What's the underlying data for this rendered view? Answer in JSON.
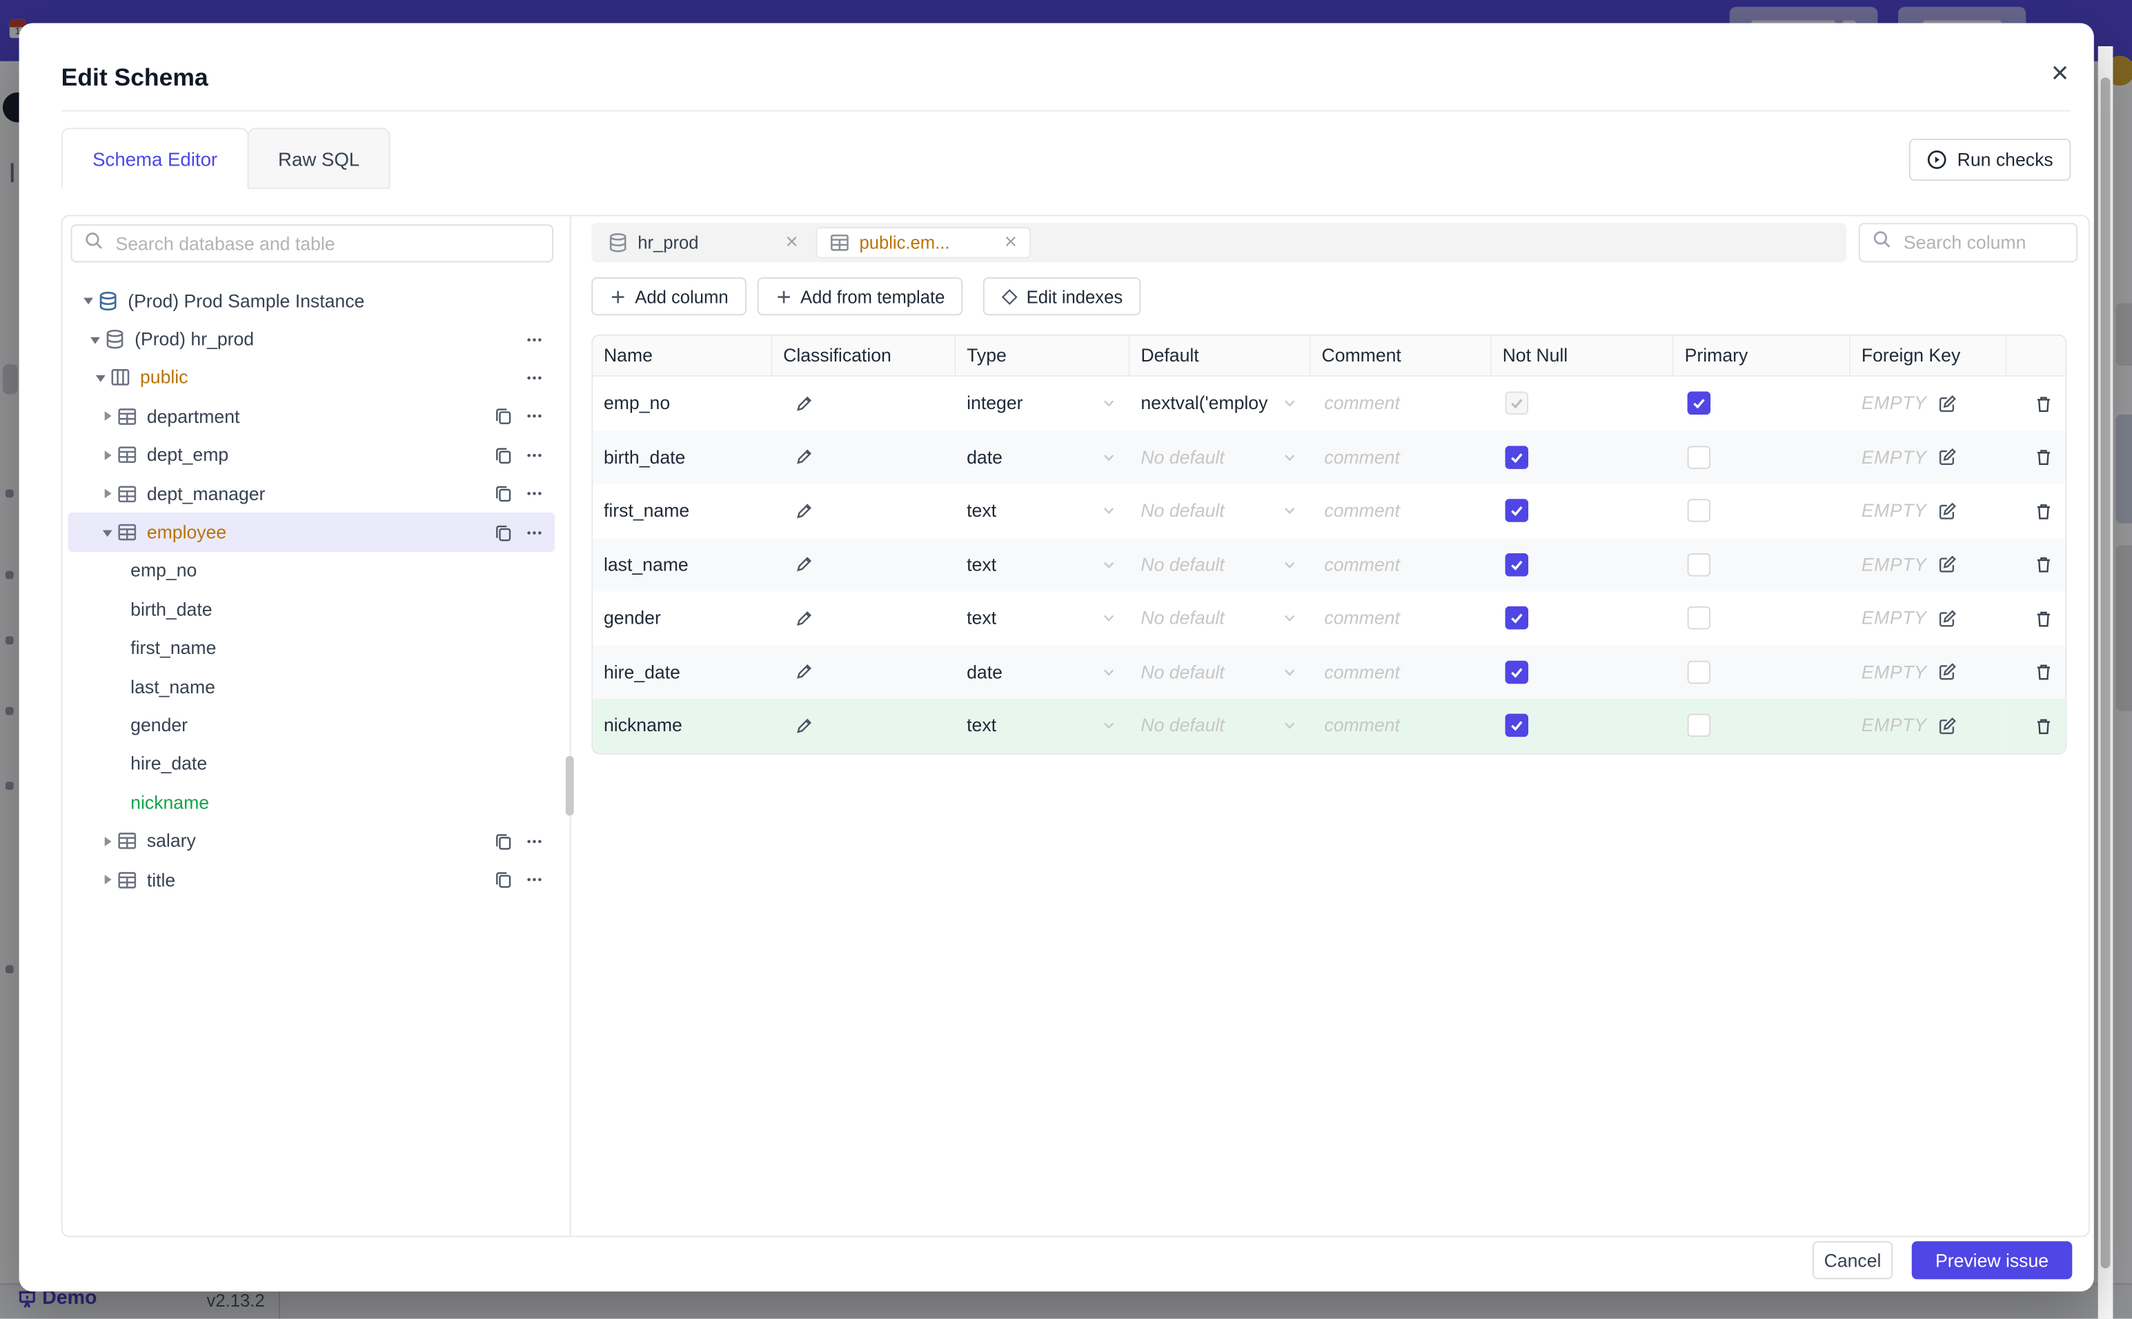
{
  "colors": {
    "accent_indigo": "#4f46e5",
    "header_purple": "#4b43d6",
    "amber_highlight": "#b87309",
    "green_added": "#15a34a",
    "added_row_bg": "#e8f7ee",
    "selected_tree_bg": "#ebeafb"
  },
  "underlay": {
    "demo_label": "Demo",
    "version": "v2.13.2"
  },
  "modal": {
    "title": "Edit Schema",
    "close_icon": "×",
    "tabs": [
      {
        "label": "Schema Editor",
        "active": true
      },
      {
        "label": "Raw SQL",
        "active": false
      }
    ],
    "run_checks_label": "Run checks"
  },
  "sidebar": {
    "search_placeholder": "Search database and table",
    "tree": [
      {
        "label": "(Prod) Prod Sample Instance",
        "level": 0,
        "caret": "open",
        "icon": "postgres",
        "color": "default",
        "selected": false,
        "copy": false,
        "more": false
      },
      {
        "label": "(Prod) hr_prod",
        "level": 1,
        "caret": "open",
        "icon": "database",
        "color": "default",
        "selected": false,
        "copy": false,
        "more": true
      },
      {
        "label": "public",
        "level": 2,
        "caret": "open",
        "icon": "schema",
        "color": "amber",
        "selected": false,
        "copy": false,
        "more": true
      },
      {
        "label": "department",
        "level": 3,
        "caret": "closed",
        "icon": "table",
        "color": "default",
        "selected": false,
        "copy": true,
        "more": true
      },
      {
        "label": "dept_emp",
        "level": 3,
        "caret": "closed",
        "icon": "table",
        "color": "default",
        "selected": false,
        "copy": true,
        "more": true
      },
      {
        "label": "dept_manager",
        "level": 3,
        "caret": "closed",
        "icon": "table",
        "color": "default",
        "selected": false,
        "copy": true,
        "more": true
      },
      {
        "label": "employee",
        "level": 3,
        "caret": "open",
        "icon": "table",
        "color": "amber",
        "selected": true,
        "copy": true,
        "more": true
      },
      {
        "label": "emp_no",
        "level": 4,
        "caret": "none",
        "icon": "none",
        "color": "default",
        "selected": false,
        "copy": false,
        "more": false
      },
      {
        "label": "birth_date",
        "level": 4,
        "caret": "none",
        "icon": "none",
        "color": "default",
        "selected": false,
        "copy": false,
        "more": false
      },
      {
        "label": "first_name",
        "level": 4,
        "caret": "none",
        "icon": "none",
        "color": "default",
        "selected": false,
        "copy": false,
        "more": false
      },
      {
        "label": "last_name",
        "level": 4,
        "caret": "none",
        "icon": "none",
        "color": "default",
        "selected": false,
        "copy": false,
        "more": false
      },
      {
        "label": "gender",
        "level": 4,
        "caret": "none",
        "icon": "none",
        "color": "default",
        "selected": false,
        "copy": false,
        "more": false
      },
      {
        "label": "hire_date",
        "level": 4,
        "caret": "none",
        "icon": "none",
        "color": "default",
        "selected": false,
        "copy": false,
        "more": false
      },
      {
        "label": "nickname",
        "level": 4,
        "caret": "none",
        "icon": "none",
        "color": "green",
        "selected": false,
        "copy": false,
        "more": false
      },
      {
        "label": "salary",
        "level": 3,
        "caret": "closed",
        "icon": "table",
        "color": "default",
        "selected": false,
        "copy": true,
        "more": true
      },
      {
        "label": "title",
        "level": 3,
        "caret": "closed",
        "icon": "table",
        "color": "default",
        "selected": false,
        "copy": true,
        "more": true
      }
    ]
  },
  "editor": {
    "chips": [
      {
        "label": "hr_prod",
        "icon": "database",
        "active": false
      },
      {
        "label": "public.em...",
        "icon": "table",
        "active": true
      }
    ],
    "search_placeholder": "Search column",
    "toolbar": [
      {
        "icon": "plus",
        "label": "Add column"
      },
      {
        "icon": "plus",
        "label": "Add from template"
      },
      {
        "icon": "diamond",
        "label": "Edit indexes"
      }
    ],
    "table": {
      "headers": [
        "Name",
        "Classification",
        "Type",
        "Default",
        "Comment",
        "Not Null",
        "Primary",
        "Foreign Key",
        ""
      ],
      "comment_placeholder": "comment",
      "no_default_label": "No default",
      "fk_empty_label": "EMPTY",
      "rows": [
        {
          "name": "emp_no",
          "type": "integer",
          "default": "nextval('employ",
          "default_is_placeholder": false,
          "not_null": "checked_disabled",
          "primary": "checked",
          "stripe": false,
          "added": false
        },
        {
          "name": "birth_date",
          "type": "date",
          "default": "No default",
          "default_is_placeholder": true,
          "not_null": "checked",
          "primary": "unchecked",
          "stripe": true,
          "added": false
        },
        {
          "name": "first_name",
          "type": "text",
          "default": "No default",
          "default_is_placeholder": true,
          "not_null": "checked",
          "primary": "unchecked",
          "stripe": false,
          "added": false
        },
        {
          "name": "last_name",
          "type": "text",
          "default": "No default",
          "default_is_placeholder": true,
          "not_null": "checked",
          "primary": "unchecked",
          "stripe": true,
          "added": false
        },
        {
          "name": "gender",
          "type": "text",
          "default": "No default",
          "default_is_placeholder": true,
          "not_null": "checked",
          "primary": "unchecked",
          "stripe": false,
          "added": false
        },
        {
          "name": "hire_date",
          "type": "date",
          "default": "No default",
          "default_is_placeholder": true,
          "not_null": "checked",
          "primary": "unchecked",
          "stripe": true,
          "added": false
        },
        {
          "name": "nickname",
          "type": "text",
          "default": "No default",
          "default_is_placeholder": true,
          "not_null": "checked",
          "primary": "unchecked",
          "stripe": false,
          "added": true
        }
      ]
    }
  },
  "footer": {
    "cancel_label": "Cancel",
    "primary_label": "Preview issue"
  }
}
